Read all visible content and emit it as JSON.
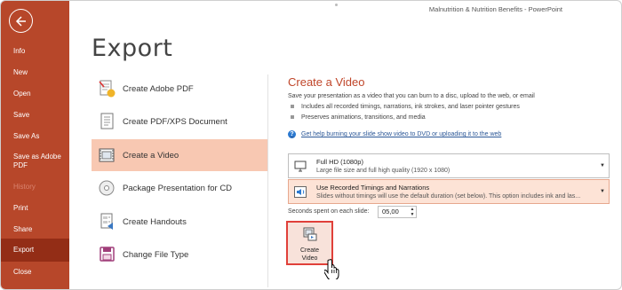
{
  "window": {
    "title": "Malnutrition & Nutrition Benefits  -  PowerPoint"
  },
  "sidebar": {
    "back_icon": "arrow-left-icon",
    "items": [
      {
        "label": "Info",
        "state": "normal"
      },
      {
        "label": "New",
        "state": "normal"
      },
      {
        "label": "Open",
        "state": "normal"
      },
      {
        "label": "Save",
        "state": "normal"
      },
      {
        "label": "Save As",
        "state": "normal"
      },
      {
        "label": "Save as Adobe PDF",
        "state": "normal"
      },
      {
        "label": "History",
        "state": "disabled"
      },
      {
        "label": "Print",
        "state": "normal"
      },
      {
        "label": "Share",
        "state": "normal"
      },
      {
        "label": "Export",
        "state": "active"
      },
      {
        "label": "Close",
        "state": "normal"
      }
    ]
  },
  "page": {
    "title": "Export"
  },
  "options": [
    {
      "label": "Create Adobe PDF",
      "icon": "adobe-pdf-icon"
    },
    {
      "label": "Create PDF/XPS Document",
      "icon": "pdf-xps-document-icon"
    },
    {
      "label": "Create a Video",
      "icon": "video-icon",
      "active": true
    },
    {
      "label": "Package Presentation for CD",
      "icon": "cd-package-icon"
    },
    {
      "label": "Create Handouts",
      "icon": "handouts-icon"
    },
    {
      "label": "Change File Type",
      "icon": "file-type-icon"
    }
  ],
  "panel": {
    "title": "Create a Video",
    "description": "Save your presentation as a video that you can burn to a disc, upload to the web, or email",
    "bullets": [
      "Includes all recorded timings, narrations, ink strokes, and laser pointer gestures",
      "Preserves animations, transitions, and media"
    ],
    "help_link": "Get help burning your slide show video to DVD or uploading it to the web",
    "quality_dropdown": {
      "title": "Full HD (1080p)",
      "subtitle": "Large file size and full high quality (1920 x 1080)"
    },
    "timings_dropdown": {
      "title": "Use Recorded Timings and Narrations",
      "subtitle": "Slides without timings will use the default duration (set below). This option includes ink and las..."
    },
    "seconds_label": "Seconds spent on each slide:",
    "seconds_value": "05,00",
    "create_button": {
      "line1": "Create",
      "line2": "Video"
    }
  },
  "colors": {
    "sidebar": "#b7472a",
    "sidebar_active": "#932d16",
    "accent_text": "#c0462a",
    "active_option": "#f8c8b2",
    "create_button_border": "#e0403a"
  }
}
